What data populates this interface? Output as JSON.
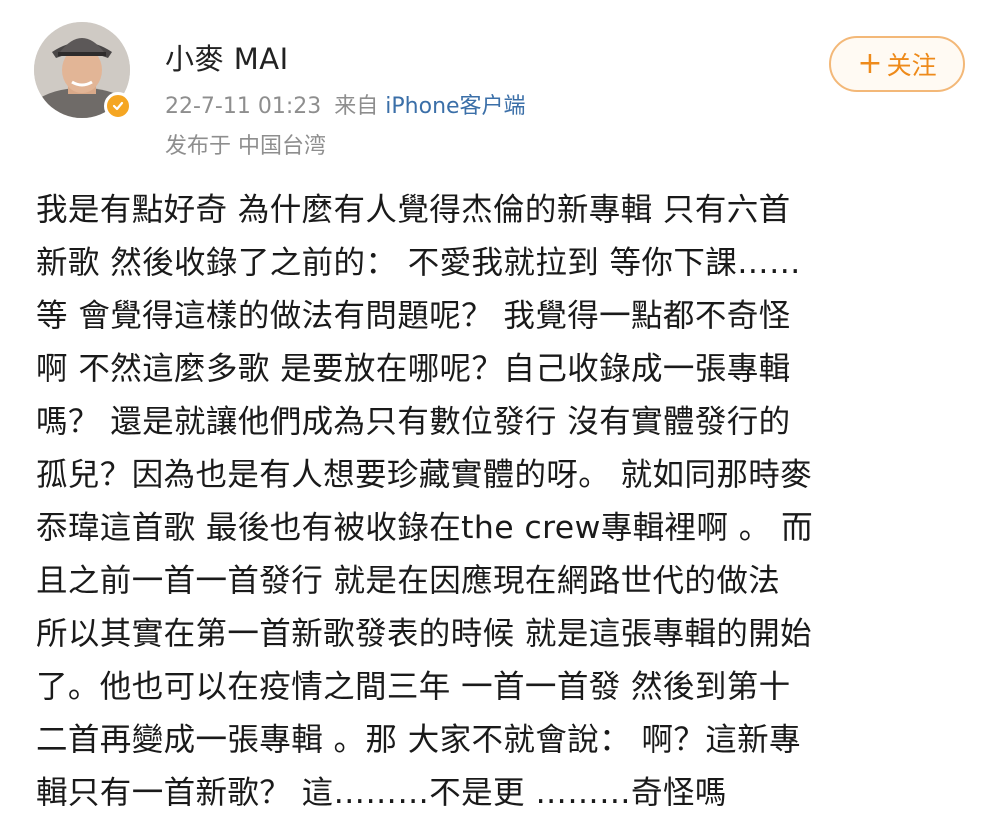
{
  "post": {
    "author": {
      "name": "小麥 MAI",
      "avatar_icon": "person-avatar-icon",
      "verified_icon": "verified-badge-icon",
      "verified_color": "#f5a623"
    },
    "timestamp": "22-7-11 01:23",
    "source_prefix": "来自",
    "source_client": "iPhone客户端",
    "location": "发布于 中国台湾",
    "follow_button": {
      "icon": "plus-icon",
      "icon_glyph": "+",
      "label": "关注",
      "accent_color": "#ee8a1a"
    },
    "lines": [
      "我是有點好奇 為什麼有人覺得杰倫的新專輯 只有六首",
      "新歌 然後收錄了之前的： 不愛我就拉到 等你下課……",
      "等 會覺得這樣的做法有問題呢？ 我覺得一點都不奇怪",
      "啊 不然這麼多歌 是要放在哪呢？自己收錄成一張專輯",
      "嗎？ 還是就讓他們成為只有數位發行 沒有實體發行的",
      "孤兒？因為也是有人想要珍藏實體的呀。 就如同那時麥",
      "忝瑋這首歌 最後也有被收錄在the crew專輯裡啊 。 而",
      "且之前一首一首發行 就是在因應現在網路世代的做法",
      "所以其實在第一首新歌發表的時候 就是這張專輯的開始",
      "了。他也可以在疫情之間三年 一首一首發 然後到第十",
      "二首再變成一張專輯 。那 大家不就會說： 啊？這新專",
      "輯只有一首新歌？ 這………不是更 ………奇怪嗎"
    ]
  }
}
